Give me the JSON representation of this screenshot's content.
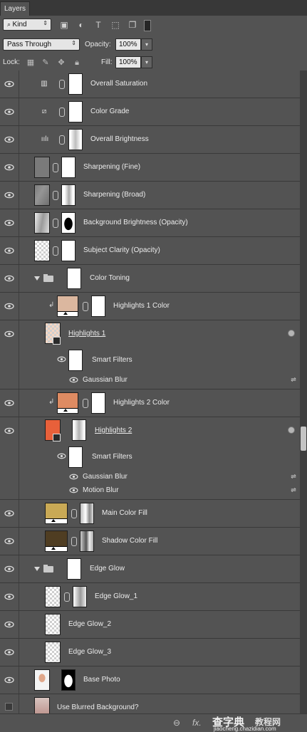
{
  "panel": {
    "tab": "Layers"
  },
  "filter": {
    "kind": "Kind"
  },
  "blend": {
    "mode": "Pass Through",
    "opacity_label": "Opacity:",
    "opacity": "100%"
  },
  "lock": {
    "label": "Lock:",
    "fill_label": "Fill:",
    "fill": "100%"
  },
  "layers": [
    "Overall Saturation",
    "Color Grade",
    "Overall Brightness",
    "Sharpening (Fine)",
    "Sharpening (Broad)",
    "Background Brightness (Opacity)",
    "Subject Clarity (Opacity)",
    "Color Toning",
    "Highlights 1 Color",
    "Highlights 1",
    "Highlights 2 Color",
    "Highlights 2",
    "Main Color Fill",
    "Shadow Color Fill",
    "Edge Glow",
    "Edge Glow_1",
    "Edge Glow_2",
    "Edge Glow_3",
    "Base Photo",
    "Use Blurred Background?"
  ],
  "smart_filters": {
    "label": "Smart Filters",
    "h1_filters": [
      "Gaussian Blur"
    ],
    "h2_filters": [
      "Gaussian Blur",
      "Motion Blur"
    ]
  },
  "colors": {
    "highlights1": "#dbb79f",
    "highlights2": "#de8b62",
    "main_fill": "#c9a955",
    "shadow_fill": "#4f3d22",
    "highlights2_thumb": "#e8603a"
  },
  "watermark": {
    "line1": "查字典",
    "line2": "教程网",
    "url": "jiaocheng.chazidian.com"
  }
}
